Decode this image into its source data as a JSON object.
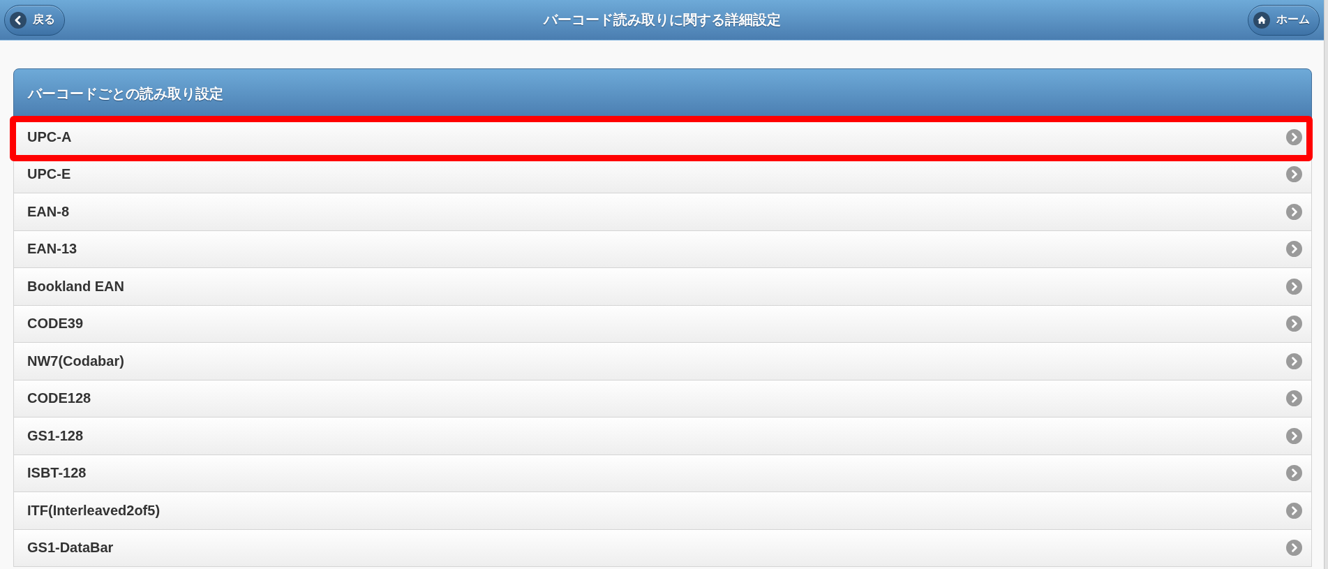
{
  "header": {
    "back_button": "戻る",
    "title": "バーコード読み取りに関する詳細設定",
    "home_button": "ホーム"
  },
  "panel": {
    "title": "バーコードごとの読み取り設定",
    "rows": [
      {
        "label": "UPC-A",
        "highlighted": true
      },
      {
        "label": "UPC-E",
        "highlighted": false
      },
      {
        "label": "EAN-8",
        "highlighted": false
      },
      {
        "label": "EAN-13",
        "highlighted": false
      },
      {
        "label": "Bookland EAN",
        "highlighted": false
      },
      {
        "label": "CODE39",
        "highlighted": false
      },
      {
        "label": "NW7(Codabar)",
        "highlighted": false
      },
      {
        "label": "CODE128",
        "highlighted": false
      },
      {
        "label": "GS1-128",
        "highlighted": false
      },
      {
        "label": "ISBT-128",
        "highlighted": false
      },
      {
        "label": "ITF(Interleaved2of5)",
        "highlighted": false
      },
      {
        "label": "GS1-DataBar",
        "highlighted": false
      }
    ]
  }
}
